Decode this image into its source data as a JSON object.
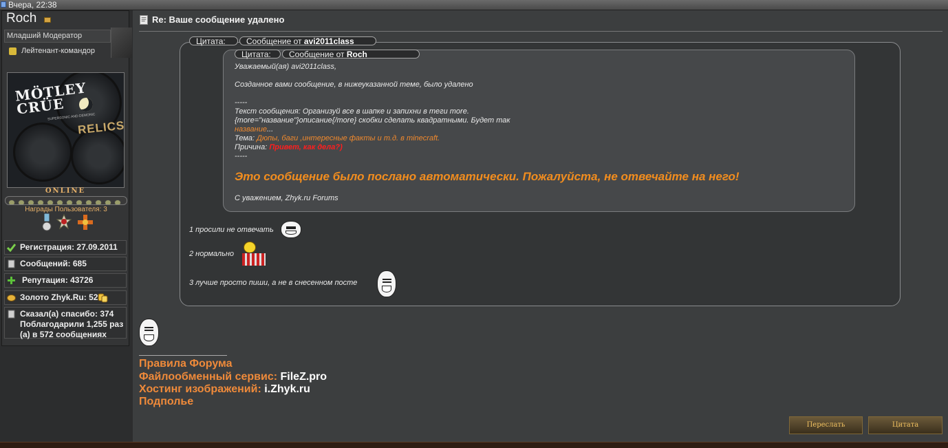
{
  "topbar": {
    "date": "Вчера, 22:38"
  },
  "user": {
    "name": "Roch",
    "title": "Младший Модератор",
    "rank": "Лейтенант-командор",
    "avatar": {
      "logo": "MÖTLEY CRÜE",
      "subtitle": "SUPERSONIC AND DEMONIC",
      "album": "RELICS"
    },
    "online_label": "ONLINE",
    "awards_label": "Награды Пользователя: 3",
    "stats": {
      "registration": "Регистрация: 27.09.2011",
      "messages": "Сообщений: 685",
      "reputation": "Репутация: 43726",
      "gold": "Золото Zhyk.Ru: 52",
      "thanks": "Сказал(а) спасибо: 374 Поблагодарили 1,255 раз (а) в 572 сообщениях"
    }
  },
  "post": {
    "title": "Re: Ваше сообщение удалено",
    "quote1": {
      "label": "Цитата:",
      "from_prefix": "Сообщение от",
      "from": "avi2011class"
    },
    "quote2": {
      "label": "Цитата:",
      "from_prefix": "Сообщение от",
      "from": "Roch"
    },
    "inner": {
      "greeting": "Уважаемый(ая) avi2011class,",
      "line1": "Созданное вами сообщение, в нижеуказанной теме, было удалено",
      "dashes": "-----",
      "text_prefix": "Текст сообщения: ",
      "text": "Организуй все в шапке и запихни в теги more.",
      "text2": "{more=\"название\"}описание{/more} скобки сделать квадратными. Будет так",
      "text3_link": "название",
      "text3_end": "...",
      "topic_prefix": "Тема: ",
      "topic": "Дюпы, баги ,интересные факты и т.д. в minecraft.",
      "reason_prefix": "Причина: ",
      "reason": "Привет, как дела?)",
      "dashes2": "-----",
      "warning": "Это сообщение было послано автоматически. Пожалуйста, не отвечайте на него!",
      "regards": "С уважением, Zhyk.ru Forums"
    },
    "replies": [
      "1 просили не отвечать",
      "2 нормально",
      "3 лучше просто пиши, а не в снесенном посте"
    ],
    "signature": {
      "rules": "Правила Форума",
      "fileshare_label": "Файлообменный сервис:",
      "fileshare_value": "FileZ.pro",
      "hosting_label": "Хостинг изображений:",
      "hosting_value": "i.Zhyk.ru",
      "underground": "Подполье"
    },
    "buttons": {
      "forward": "Переслать",
      "quote": "Цитата"
    }
  },
  "colors": {
    "accent_orange": "#f0892d",
    "reason_red": "#ff1e1e",
    "background": "#3c3e3f"
  }
}
